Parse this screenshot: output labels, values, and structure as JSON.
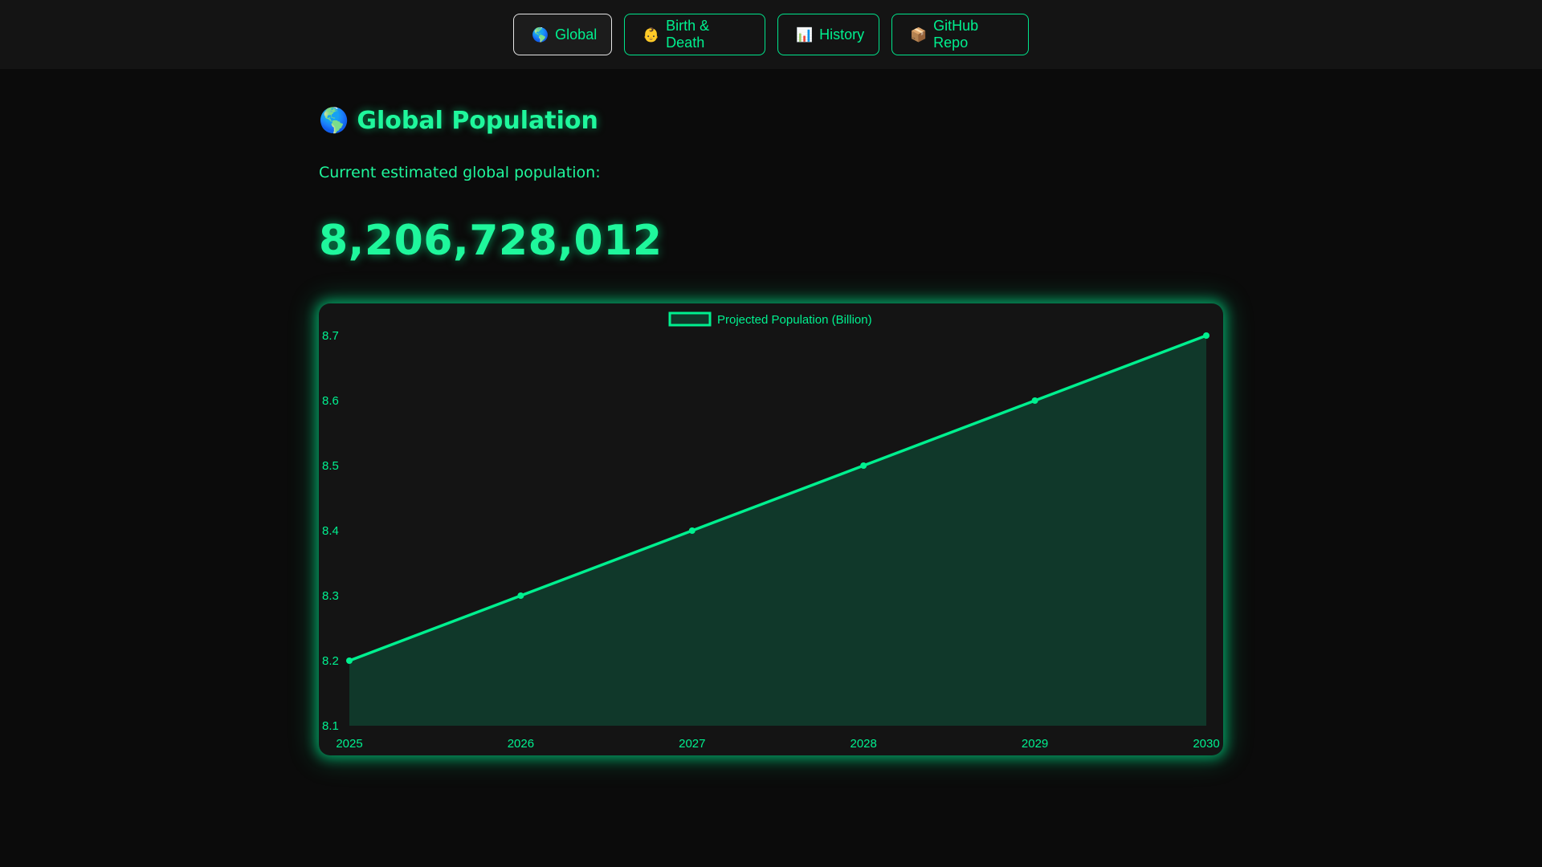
{
  "nav": {
    "items": [
      {
        "icon": "🌎",
        "icon_name": "globe-icon",
        "label": "Global",
        "active": true
      },
      {
        "icon": "👶",
        "icon_name": "baby-icon",
        "label": "Birth & Death",
        "active": false
      },
      {
        "icon": "📊",
        "icon_name": "bar-chart-icon",
        "label": "History",
        "active": false
      },
      {
        "icon": "📦",
        "icon_name": "package-icon",
        "label": "GitHub Repo",
        "active": false
      }
    ]
  },
  "page": {
    "title_icon": "🌎",
    "title": "Global Population",
    "subtitle": "Current estimated global population:",
    "population": "8,206,728,012"
  },
  "colors": {
    "accent": "#00f08f",
    "background": "#0b0b0b",
    "panel": "#141414",
    "area_fill": "#10382a"
  },
  "chart_data": {
    "type": "area",
    "x": [
      "2025",
      "2026",
      "2027",
      "2028",
      "2029",
      "2030"
    ],
    "series": [
      {
        "name": "Projected Population (Billion)",
        "values": [
          8.2,
          8.3,
          8.4,
          8.5,
          8.6,
          8.7
        ]
      }
    ],
    "yticks": [
      "8.1",
      "8.2",
      "8.3",
      "8.4",
      "8.5",
      "8.6",
      "8.7"
    ],
    "ylim": [
      8.1,
      8.7
    ],
    "legend": "top-center",
    "grid": false
  }
}
